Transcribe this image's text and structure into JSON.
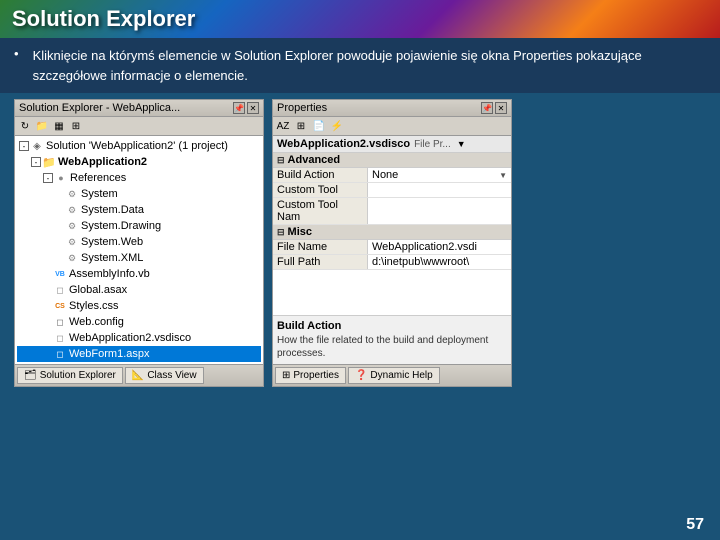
{
  "header": {
    "title": "Solution Explorer"
  },
  "bullet": {
    "text": "Kliknięcie na którymś elemencie w Solution Explorer powoduje pojawienie się okna Properties pokazujące szczegółowe informacje o elemencie."
  },
  "solution_explorer": {
    "title": "Solution Explorer - WebApplica...",
    "toolbar_buttons": [
      "📁",
      "🔄",
      "📋",
      "⚙"
    ],
    "tree": [
      {
        "level": 0,
        "expander": "-",
        "icon": "solution",
        "label": "Solution 'WebApplication2' (1 project)"
      },
      {
        "level": 1,
        "expander": "-",
        "icon": "folder",
        "label": "WebApplication2",
        "bold": true
      },
      {
        "level": 2,
        "expander": "-",
        "icon": "ref",
        "label": "References"
      },
      {
        "level": 3,
        "expander": null,
        "icon": "gear",
        "label": "System"
      },
      {
        "level": 3,
        "expander": null,
        "icon": "gear",
        "label": "System.Data"
      },
      {
        "level": 3,
        "expander": null,
        "icon": "gear",
        "label": "System.Drawing"
      },
      {
        "level": 3,
        "expander": null,
        "icon": "gear",
        "label": "System.Web"
      },
      {
        "level": 3,
        "expander": null,
        "icon": "gear",
        "label": "System.XML"
      },
      {
        "level": 2,
        "expander": null,
        "icon": "file-vb",
        "label": "AssemblyInfo.vb"
      },
      {
        "level": 2,
        "expander": null,
        "icon": "file-asax",
        "label": "Global.asax"
      },
      {
        "level": 2,
        "expander": null,
        "icon": "file-css",
        "label": "Styles.css"
      },
      {
        "level": 2,
        "expander": null,
        "icon": "file-config",
        "label": "Web.config"
      },
      {
        "level": 2,
        "expander": null,
        "icon": "file-vsdisco",
        "label": "WebApplication2.vsdisco"
      },
      {
        "level": 2,
        "expander": null,
        "icon": "file-aspx",
        "label": "WebForm1.aspx",
        "selected": true
      }
    ],
    "footer_tabs": [
      "Solution Explorer",
      "Class View"
    ]
  },
  "properties": {
    "title": "Properties",
    "filename": "WebApplication2.vsdisco",
    "filetype": "File Pr...",
    "sections": [
      {
        "name": "Advanced",
        "expanded": true,
        "rows": [
          {
            "name": "Build Action",
            "value": "None",
            "dropdown": true
          },
          {
            "name": "Custom Tool",
            "value": "",
            "dropdown": false
          },
          {
            "name": "Custom Tool Nam",
            "value": "",
            "dropdown": false
          }
        ]
      },
      {
        "name": "Misc",
        "expanded": true,
        "rows": [
          {
            "name": "File Name",
            "value": "WebApplication2.vsdi",
            "dropdown": false
          },
          {
            "name": "Full Path",
            "value": "d:\\inetpub\\wwwroot\\",
            "dropdown": false
          }
        ]
      }
    ],
    "description_label": "Build Action",
    "description_text": "How the file related to the build and deployment processes.",
    "footer_tabs": [
      "Properties",
      "Dynamic Help"
    ]
  },
  "page_number": "57",
  "icons": {
    "solution": "◈",
    "folder": "📁",
    "ref": "●",
    "gear": "⚙",
    "file-vb": "VB",
    "file-asax": "◻",
    "file-css": "CS",
    "file-config": "◻",
    "file-vsdisco": "◻",
    "file-aspx": "◻"
  }
}
